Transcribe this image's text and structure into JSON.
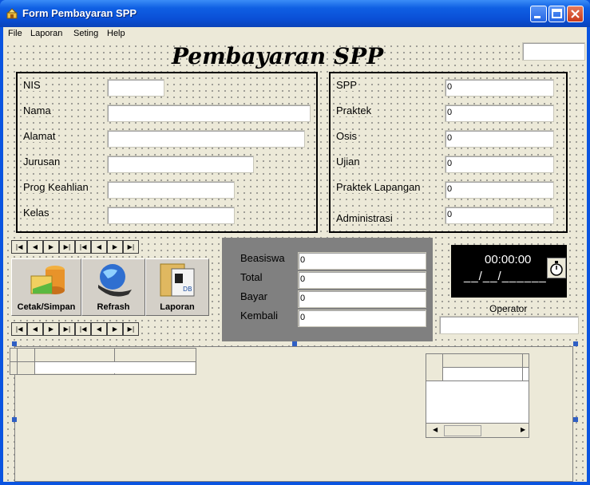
{
  "window": {
    "title": "Form Pembayaran SPP"
  },
  "menu": [
    "File",
    "Laporan",
    "Seting",
    "Help"
  ],
  "heading": "Pembayaran SPP",
  "student": {
    "nis_label": "NIS",
    "nama_label": "Nama",
    "alamat_label": "Alamat",
    "jurusan_label": "Jurusan",
    "prog_label": "Prog Keahlian",
    "kelas_label": "Kelas"
  },
  "fees": [
    {
      "label": "SPP",
      "value": "0"
    },
    {
      "label": "Praktek",
      "value": "0"
    },
    {
      "label": "Osis",
      "value": "0"
    },
    {
      "label": "Ujian",
      "value": "0"
    },
    {
      "label": "Praktek Lapangan",
      "value": "0"
    },
    {
      "label": "Administrasi",
      "value": "0"
    }
  ],
  "summary": [
    {
      "label": "Beasiswa",
      "value": "0"
    },
    {
      "label": "Total",
      "value": "0"
    },
    {
      "label": "Bayar",
      "value": "0"
    },
    {
      "label": "Kembali",
      "value": "0"
    }
  ],
  "buttons": {
    "cetak": "Cetak/Simpan",
    "refresh": "Refrash",
    "laporan": "Laporan"
  },
  "clock": {
    "time": "00:00:00",
    "date": "__/__/______"
  },
  "operator_label": "Operator",
  "colors": {
    "titlebar": "#0a54e0",
    "client": "#ece9d8",
    "summary_panel": "#808080",
    "clock_bg": "#000000"
  }
}
